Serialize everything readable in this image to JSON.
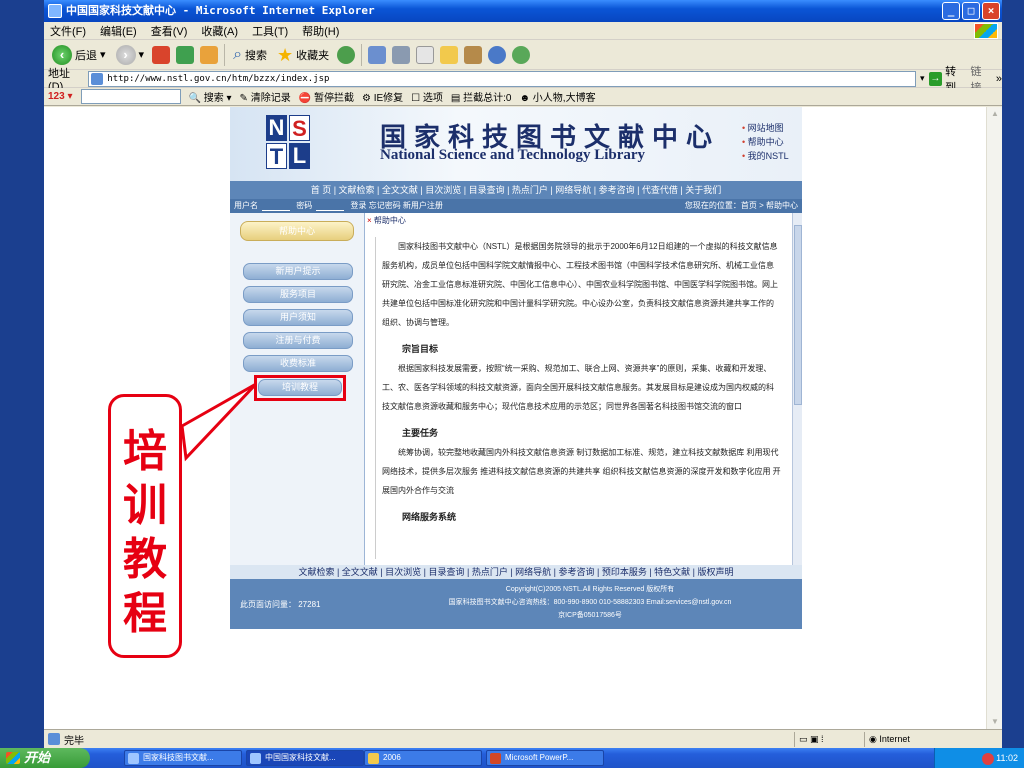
{
  "window": {
    "title": "中国国家科技文献中心 - Microsoft Internet Explorer"
  },
  "menubar": {
    "items": [
      "文件(F)",
      "编辑(E)",
      "查看(V)",
      "收藏(A)",
      "工具(T)",
      "帮助(H)"
    ]
  },
  "toolbar": {
    "back_label": "后退",
    "search_label": "搜索",
    "favorites_label": "收藏夹"
  },
  "addressbar": {
    "label": "地址(D)",
    "url": "http://www.nstl.gov.cn/htm/bzzx/index.jsp",
    "go_label": "转到",
    "links_label": "链接"
  },
  "linksbar": {
    "brand": "123",
    "search_label": "搜索",
    "clear_label": "清除记录",
    "popup_label": "暂停拦截",
    "ie_label": "IE修复",
    "options_label": "选项",
    "blocked_label": "拦截总计:0",
    "person_label": "小人物,大博客"
  },
  "site": {
    "logo": [
      "N",
      "S",
      "T",
      "L"
    ],
    "cn_title": "国家科技图书文献中心",
    "en_title": "National Science and Technology Library",
    "top_links": [
      "网站地图",
      "帮助中心",
      "我的NSTL"
    ],
    "nav": "首 页 | 文献检索 | 全文文献 | 目次浏览 | 目录查询 | 热点门户 | 网络导航 | 参考咨询 | 代查代借 | 关于我们",
    "login": {
      "user_label": "用户名",
      "pwd_label": "密码",
      "actions": "登录 忘记密码 新用户注册",
      "location": "您现在的位置：首页 > 帮助中心"
    },
    "sidebar": {
      "help_title": "帮助中心",
      "items": [
        "新用户提示",
        "服务项目",
        "用户须知",
        "注册与付费",
        "收费标准",
        "培训教程"
      ]
    },
    "crumb": "帮助中心",
    "content": {
      "intro": "国家科技图书文献中心（NSTL）是根据国务院领导的批示于2000年6月12日组建的一个虚拟的科技文献信息服务机构，成员单位包括中国科学院文献情报中心、工程技术图书馆（中国科学技术信息研究所、机械工业信息研究院、冶金工业信息标准研究院、中国化工信息中心）、中国农业科学院图书馆、中国医学科学院图书馆。网上共建单位包括中国标准化研究院和中国计量科学研究院。中心设办公室，负责科技文献信息资源共建共享工作的组织、协调与管理。",
      "h_goal": "宗旨目标",
      "goal": "根据国家科技发展需要，按照“统一采购、规范加工、联合上网、资源共享”的原则，采集、收藏和开发理、工、农、医各学科领域的科技文献资源，面向全国开展科技文献信息服务。其发展目标是建设成为国内权威的科技文献信息资源收藏和服务中心；现代信息技术应用的示范区；同世界各国著名科技图书馆交流的窗口",
      "h_task": "主要任务",
      "task": "统筹协调，较完整地收藏国内外科技文献信息资源 制订数据加工标准、规范，建立科技文献数据库 利用现代网络技术，提供多层次服务 推进科技文献信息资源的共建共享 组织科技文献信息资源的深度开发和数字化应用 开展国内外合作与交流",
      "h_net": "网络服务系统"
    },
    "footnav": "文献检索 | 全文文献 | 目次浏览 | 目录查询 | 热点门户 | 网络导航 | 参考咨询 | 预印本服务 | 特色文献 | 版权声明",
    "footer": {
      "visits": "此页面访问量： 27281",
      "copy1": "Copyright(C)2005 NSTL.All Rights Reserved 版权所有",
      "copy2": "国家科技图书文献中心咨询热线：800-990-8900 010-58882303 Email:services@nstl.gov.cn",
      "copy3": "京ICP备05017586号"
    }
  },
  "callout": {
    "text": "培训教程"
  },
  "statusbar": {
    "text": "完毕",
    "zone": "Internet"
  },
  "taskbar": {
    "start": "开始",
    "items": [
      "国家科技图书文献...",
      "中国国家科技文献...",
      "2006",
      "Microsoft PowerP..."
    ],
    "time": "11:02"
  }
}
